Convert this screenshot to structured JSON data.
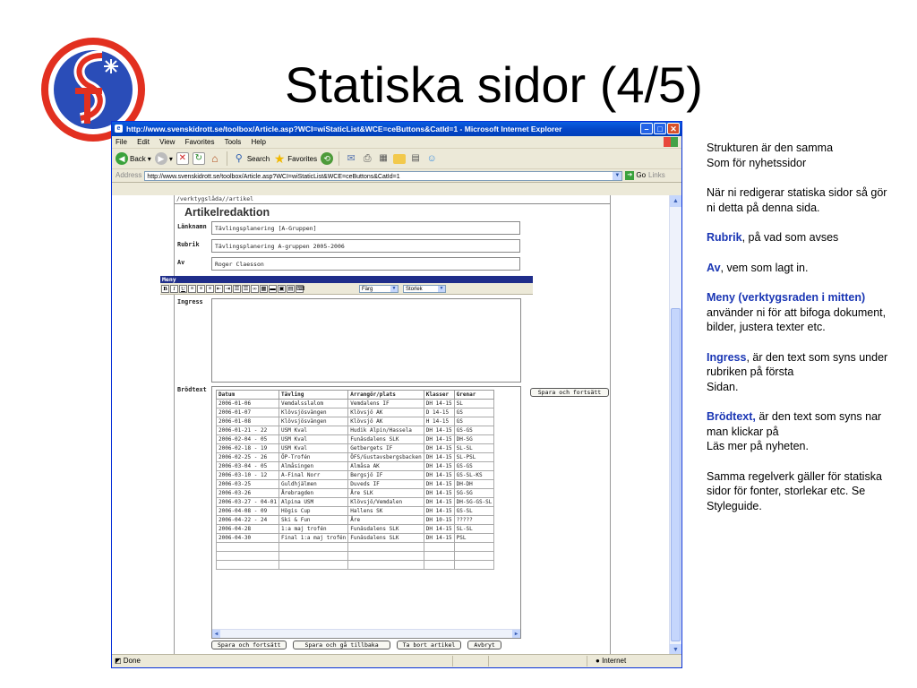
{
  "slide": {
    "title": "Statiska sidor (4/5)",
    "logo_text": "SF",
    "notes": [
      {
        "text": "Strukturen är den samma\nSom för nyhetssidor"
      },
      {
        "text": "När ni redigerar statiska sidor så gör ni detta på denna sida."
      },
      {
        "bold": "Rubrik",
        "text": ", på vad som avses"
      },
      {
        "bold": "Av",
        "text": ", vem som lagt in."
      },
      {
        "bold": "Meny (verktygsraden i mitten)",
        "text": " använder ni för att bifoga dokument, bilder, justera texter etc."
      },
      {
        "bold": "Ingress",
        "text": ", är den text som syns under rubriken på första\nSidan."
      },
      {
        "bold": "Brödtext,",
        "text": " är den text som syns nar man klickar på\nLäs mer på nyheten."
      },
      {
        "text": "Samma regelverk gäller för statiska sidor för fonter, storlekar etc. Se Styleguide."
      }
    ]
  },
  "browser": {
    "window_title": "http://www.svenskidrott.se/toolbox/Article.asp?WCI=wiStaticList&WCE=ceButtons&CatId=1 - Microsoft Internet Explorer",
    "menu": [
      "File",
      "Edit",
      "View",
      "Favorites",
      "Tools",
      "Help"
    ],
    "toolbar": {
      "back": "Back",
      "search": "Search",
      "favorites": "Favorites"
    },
    "address_label": "Address",
    "address_value": "http://www.svenskidrott.se/toolbox/Article.asp?WCI=wiStaticList&WCE=ceButtons&CatId=1",
    "go_label": "Go",
    "links_label": "Links",
    "status_text": "Done",
    "zone_text": "Internet"
  },
  "editor": {
    "breadcrumb": "/verktygslåda//artikel",
    "heading": "Artikelredaktion",
    "fields": {
      "lanknamn_label": "Länknamn",
      "lanknamn_value": "Tävlingsplanering [A-Gruppen]",
      "rubrik_label": "Rubrik",
      "rubrik_value": "Tävlingsplanering A-gruppen 2005-2006",
      "av_label": "Av",
      "av_value": "Roger Claesson"
    },
    "menu_label": "Meny",
    "color_select": "Färg",
    "size_select": "Storlek",
    "ingress_label": "Ingress",
    "brodtext_label": "Brödtext",
    "save_continue_top": "Spara och fortsätt",
    "buttons": {
      "save_continue": "Spara och fortsätt",
      "save_back": "Spara och gå tillbaka",
      "delete": "Ta bort artikel",
      "cancel": "Avbryt"
    },
    "table": {
      "headers": [
        "Datum",
        "Tävling",
        "Arrangör/plats",
        "Klasser",
        "Grenar"
      ],
      "rows": [
        [
          "2006-01-06",
          "Vemdalsslalom",
          "Vemdalens IF",
          "DH 14-15",
          "SL"
        ],
        [
          "2006-01-07",
          "Klövsjösvängen",
          "Klövsjö AK",
          "D 14-15",
          "GS"
        ],
        [
          "2006-01-08",
          "Klövsjösvängen",
          "Klövsjö AK",
          "H 14-15",
          "GS"
        ],
        [
          "2006-01-21 - 22",
          "USM Kval",
          "Hudik Alpin/Hassela",
          "DH 14-15",
          "GS-GS"
        ],
        [
          "2006-02-04 - 05",
          "USM Kval",
          "Funäsdalens SLK",
          "DH 14-15",
          "DH-SG"
        ],
        [
          "2006-02-18 - 19",
          "USM Kval",
          "Getbergets IF",
          "DH 14-15",
          "SL-SL"
        ],
        [
          "2006-02-25 - 26",
          "ÖP-Trofén",
          "ÖFS/Gustavsbergsbacken",
          "DH 14-15",
          "SL-PSL"
        ],
        [
          "2006-03-04 - 05",
          "Almåsingen",
          "Almåsa AK",
          "DH 14-15",
          "GS-GS"
        ],
        [
          "2006-03-10 - 12",
          "A-Final Norr",
          "Bergsjö IF",
          "DH 14-15",
          "GS-SL-KS"
        ],
        [
          "2006-03-25",
          "Guldhjälmen",
          "Duveds IF",
          "DH 14-15",
          "DH-DH"
        ],
        [
          "2006-03-26",
          "Årebragden",
          "Åre SLK",
          "DH 14-15",
          "SG-SG"
        ],
        [
          "2006-03-27 - 04-01",
          "Alpina USM",
          "Klövsjö/Vemdalen",
          "DH 14-15",
          "DH-SG-GS-SL"
        ],
        [
          "2006-04-08 - 09",
          "Högis Cup",
          "Hallens SK",
          "DH 14-15",
          "GS-SL"
        ],
        [
          "2006-04-22 - 24",
          "Ski & Fun",
          "Åre",
          "DH 10-15",
          "?????"
        ],
        [
          "2006-04-28",
          "1:a maj trofén",
          "Funäsdalens SLK",
          "DH 14-15",
          "SL-SL"
        ],
        [
          "2006-04-30",
          "Final 1:a maj trofén",
          "Funäsdalens SLK",
          "DH 14-15",
          "PSL"
        ],
        [
          "",
          "",
          "",
          "",
          ""
        ],
        [
          "",
          "",
          "",
          "",
          ""
        ],
        [
          "",
          "",
          "",
          "",
          ""
        ]
      ]
    }
  },
  "colors": {
    "titlebar": "#0a5ee0",
    "accent_blue": "#1a36b4",
    "logo_red": "#e23020",
    "logo_blue": "#2a4db8"
  }
}
